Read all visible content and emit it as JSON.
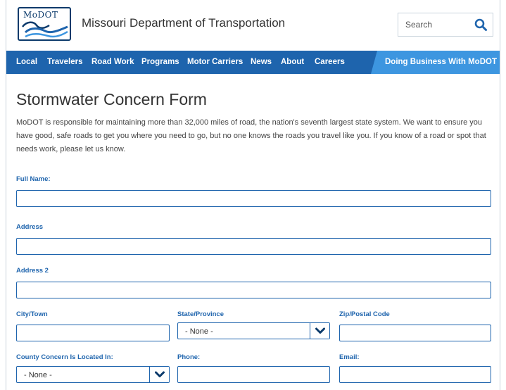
{
  "header": {
    "logo_text": "MoDOT",
    "site_title": "Missouri Department of Transportation",
    "search_placeholder": "Search"
  },
  "nav": {
    "items": [
      "Local",
      "Travelers",
      "Road Work",
      "Programs",
      "Motor Carriers",
      "News",
      "About",
      "Careers"
    ],
    "business_label": "Doing Business With MoDOT"
  },
  "page": {
    "title": "Stormwater Concern Form",
    "intro": "MoDOT is responsible for maintaining more than 32,000 miles of road, the nation's seventh largest state system. We want to ensure you have good, safe roads to get you where you need to go, but no one knows the roads you travel like you. If you know of a road or spot that needs work, please let us know."
  },
  "form": {
    "full_name_label": "Full Name:",
    "address_label": "Address",
    "address2_label": "Address 2",
    "city_label": "City/Town",
    "state_label": "State/Province",
    "state_value": "- None -",
    "zip_label": "Zip/Postal Code",
    "county_label": "County Concern Is Located In:",
    "county_value": "- None -",
    "phone_label": "Phone:",
    "email_label": "Email:"
  },
  "colors": {
    "nav_bg": "#1e64ad",
    "nav_business_bg": "#3d96e0",
    "label": "#1e64ad",
    "logo": "#0b3a6b"
  },
  "icons": {
    "search": "search-icon",
    "chevron": "chevron-down-icon"
  }
}
